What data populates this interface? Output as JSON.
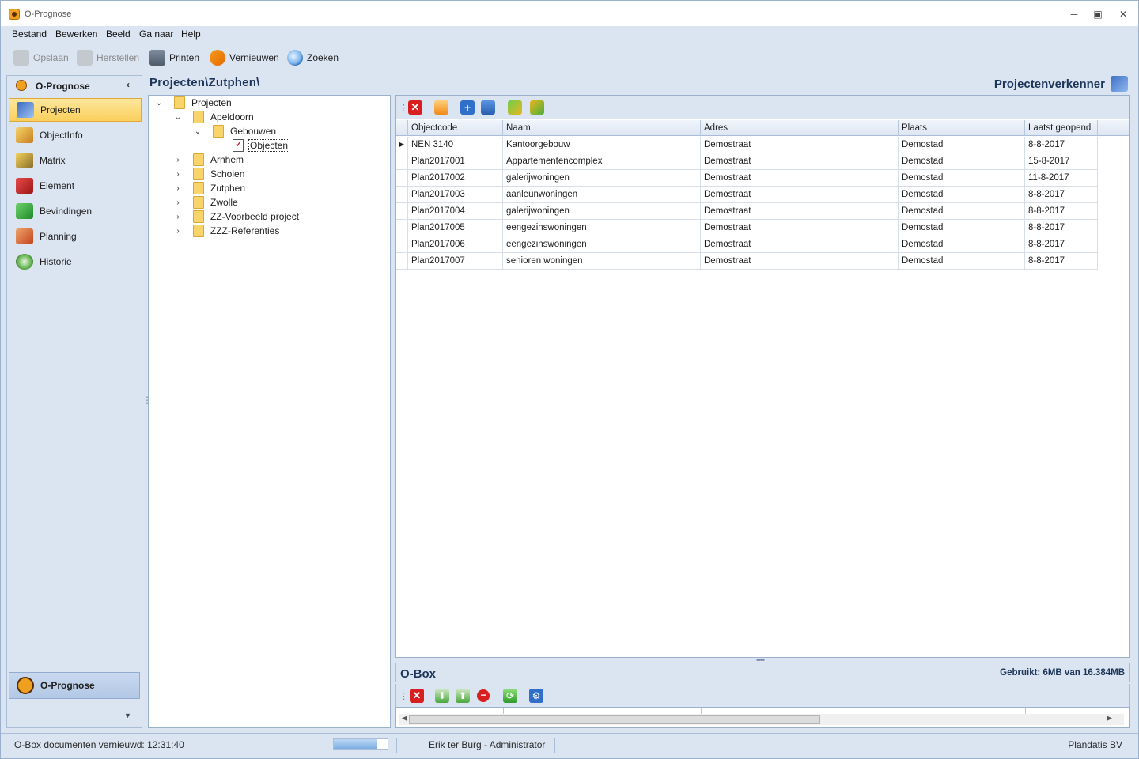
{
  "window": {
    "title": "O-Prognose"
  },
  "menu": [
    "Bestand",
    "Bewerken",
    "Beeld",
    "Ga naar",
    "Help"
  ],
  "toolbar": {
    "save": "Opslaan",
    "restore": "Herstellen",
    "print": "Printen",
    "refresh": "Vernieuwen",
    "search": "Zoeken"
  },
  "nav": {
    "header": "O-Prognose",
    "items": [
      "Projecten",
      "ObjectInfo",
      "Matrix",
      "Element",
      "Bevindingen",
      "Planning",
      "Historie"
    ],
    "active": "Projecten",
    "bottom_button": "O-Prognose"
  },
  "breadcrumb": "Projecten\\Zutphen\\",
  "explorer_title": "Projectenverkenner",
  "tree": {
    "root": "Projecten",
    "apeldoorn": "Apeldoorn",
    "gebouwen": "Gebouwen",
    "objecten": "Objecten",
    "others": [
      "Arnhem",
      "Scholen",
      "Zutphen",
      "Zwolle",
      "ZZ-Voorbeeld project",
      "ZZZ-Referenties"
    ]
  },
  "grid": {
    "columns": [
      "Objectcode",
      "Naam",
      "Adres",
      "Plaats",
      "Laatst geopend"
    ],
    "rows": [
      [
        "NEN 3140",
        "Kantoorgebouw",
        "Demostraat",
        "Demostad",
        "8-8-2017"
      ],
      [
        "Plan2017001",
        "Appartementencomplex",
        "Demostraat",
        "Demostad",
        "15-8-2017"
      ],
      [
        "Plan2017002",
        "galerijwoningen",
        "Demostraat",
        "Demostad",
        "11-8-2017"
      ],
      [
        "Plan2017003",
        "aanleunwoningen",
        "Demostraat",
        "Demostad",
        "8-8-2017"
      ],
      [
        "Plan2017004",
        "galerijwoningen",
        "Demostraat",
        "Demostad",
        "8-8-2017"
      ],
      [
        "Plan2017005",
        "eengezinswoningen",
        "Demostraat",
        "Demostad",
        "8-8-2017"
      ],
      [
        "Plan2017006",
        "eengezinswoningen",
        "Demostraat",
        "Demostad",
        "8-8-2017"
      ],
      [
        "Plan2017007",
        "senioren woningen",
        "Demostraat",
        "Demostad",
        "8-8-2017"
      ]
    ]
  },
  "obox": {
    "title": "O-Box",
    "usage": "Gebruikt: 6MB van 16.384MB"
  },
  "status": {
    "obox_refreshed": "O-Box documenten vernieuwd: 12:31:40",
    "progress": 0.8,
    "user": "Erik ter Burg - Administrator",
    "company": "Plandatis BV"
  }
}
